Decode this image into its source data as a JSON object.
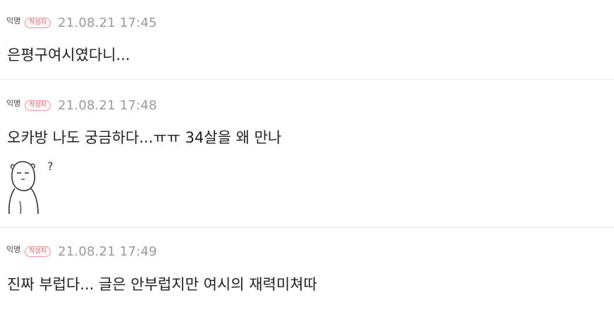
{
  "comments": [
    {
      "author": "익명",
      "badge": "작성자",
      "time": "21.08.21 17:45",
      "text": "은평구여시였다니..."
    },
    {
      "author": "익명",
      "badge": "작성자",
      "time": "21.08.21 17:48",
      "text": "오카방 나도 궁금하다...ㅠㅠ 34살을 왜 만나",
      "sticker": {
        "icon": "confused-character-sticker-icon",
        "mark": "?"
      }
    },
    {
      "author": "익명",
      "badge": "작성자",
      "time": "21.08.21 17:49",
      "text": "진짜 부럽다... 글은 안부럽지만 여시의 재력미쳐따"
    }
  ],
  "colors": {
    "badge_text": "#e2606a",
    "badge_border": "#e89aa0",
    "timestamp": "#9a9a9a",
    "divider": "#ececec"
  }
}
